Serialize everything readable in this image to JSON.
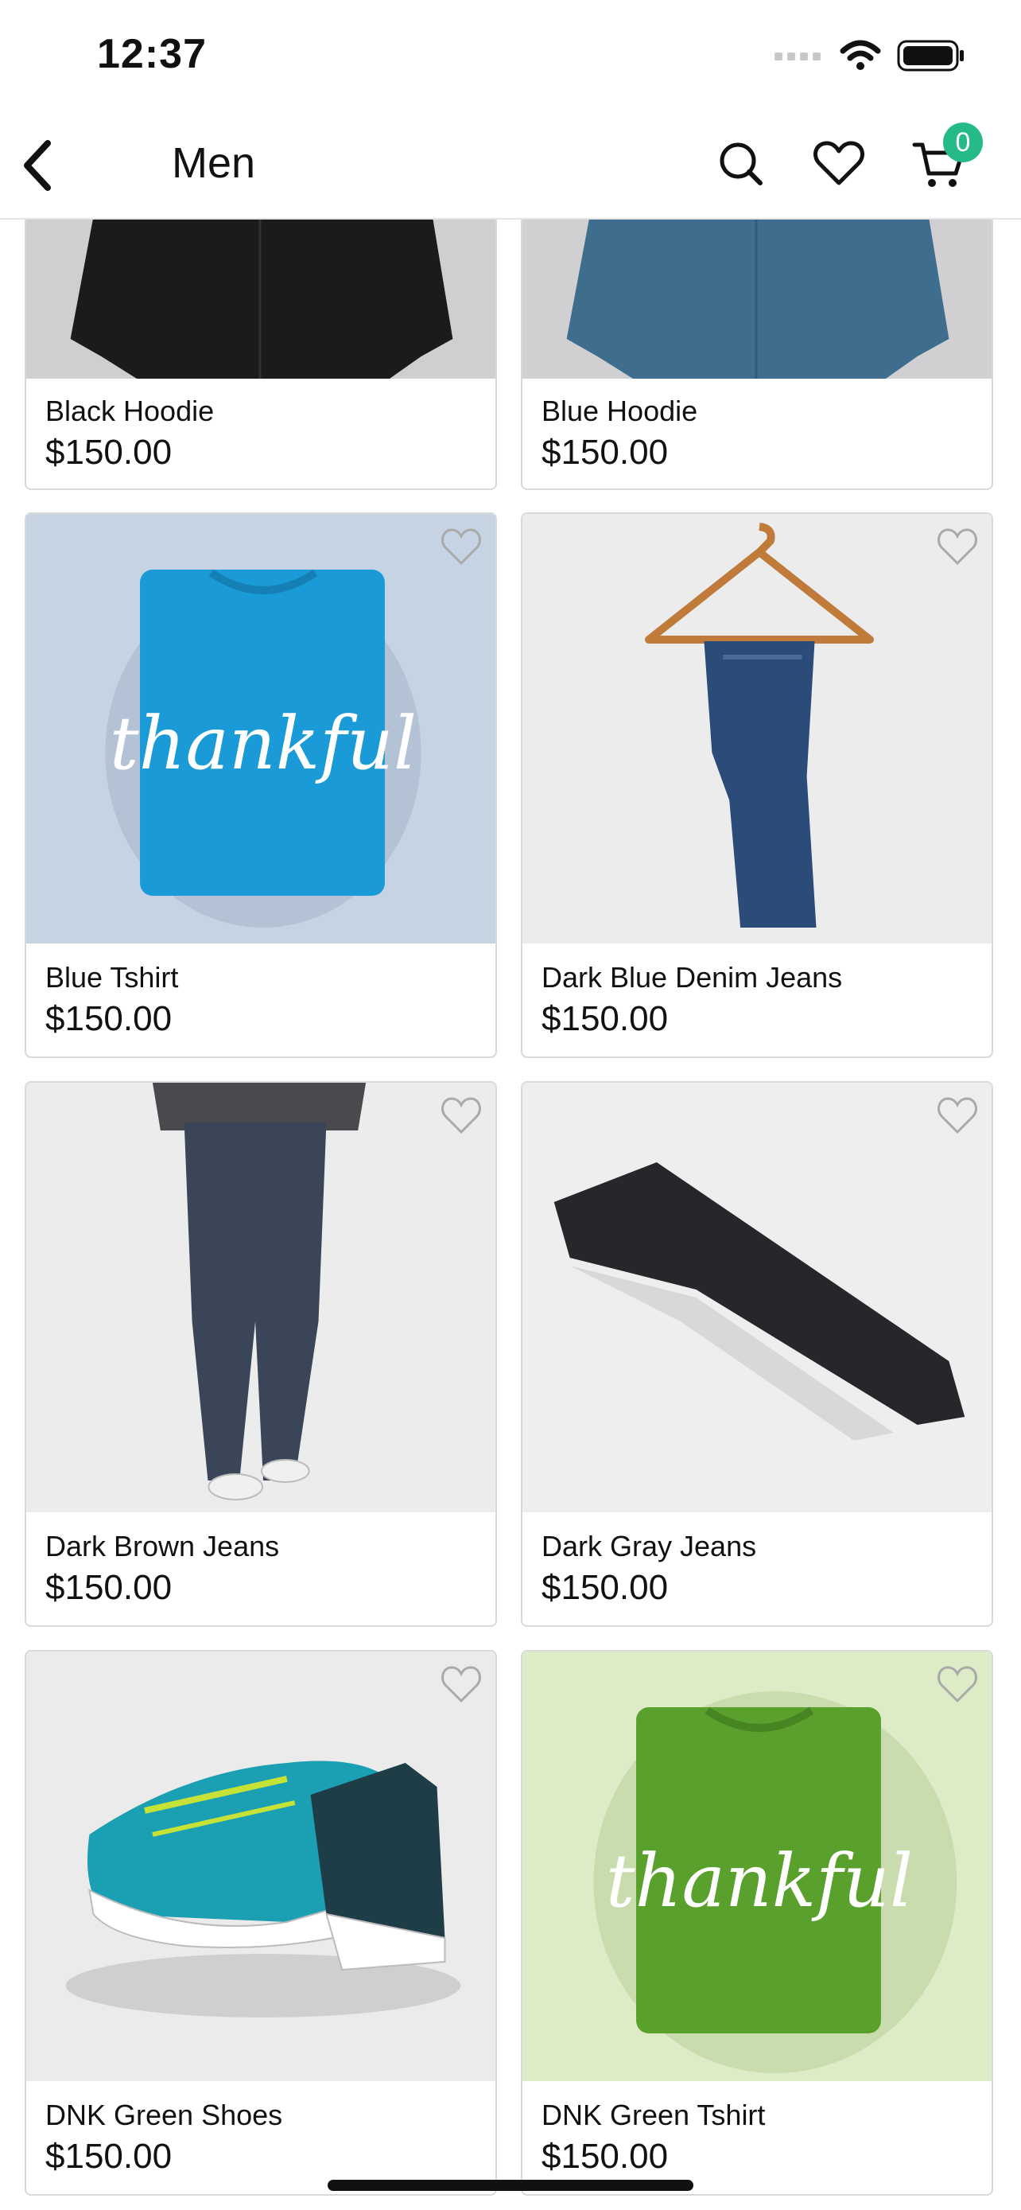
{
  "status_bar": {
    "time": "12:37"
  },
  "nav": {
    "title": "Men",
    "cart_count": "0"
  },
  "products": [
    {
      "name": "Black Hoodie",
      "price": "$150.00"
    },
    {
      "name": "Blue Hoodie",
      "price": "$150.00"
    },
    {
      "name": "Blue Tshirt",
      "price": "$150.00",
      "print": "thankful"
    },
    {
      "name": "Dark Blue Denim Jeans",
      "price": "$150.00"
    },
    {
      "name": "Dark Brown Jeans",
      "price": "$150.00"
    },
    {
      "name": "Dark Gray Jeans",
      "price": "$150.00"
    },
    {
      "name": "DNK Green Shoes",
      "price": "$150.00"
    },
    {
      "name": "DNK Green Tshirt",
      "price": "$150.00",
      "print": "thankful"
    }
  ],
  "colors": {
    "badge": "#26b98a",
    "card_border": "#d9d9d9"
  }
}
